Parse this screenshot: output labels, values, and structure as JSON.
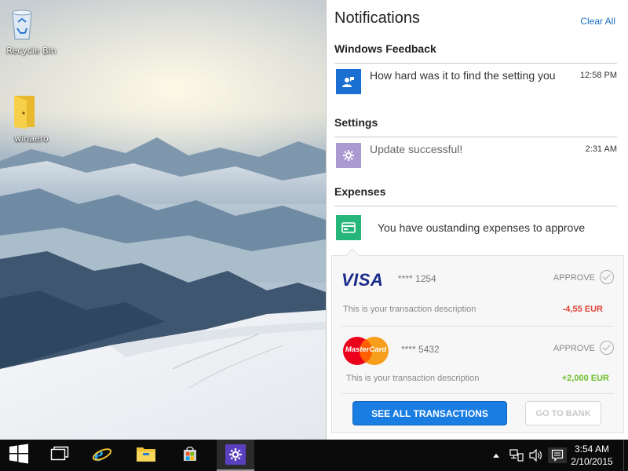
{
  "desktop": {
    "icons": [
      {
        "label": "Recycle Bin",
        "icon": "recycle-bin-icon"
      },
      {
        "label": "winaero",
        "icon": "folder-icon"
      }
    ]
  },
  "notifications": {
    "title": "Notifications",
    "clear_all": "Clear All",
    "groups": [
      {
        "title": "Windows Feedback",
        "items": [
          {
            "text": "How hard was it to find the setting you",
            "time": "12:58 PM",
            "icon": "feedback-icon",
            "icon_bg": "#1a6fd0"
          }
        ]
      },
      {
        "title": "Settings",
        "items": [
          {
            "text": "Update successful!",
            "time": "2:31 AM",
            "icon": "gear-icon",
            "icon_bg": "#a99bd1"
          }
        ]
      },
      {
        "title": "Expenses",
        "items": [
          {
            "text": "You have oustanding expenses to approve",
            "icon": "wallet-icon",
            "icon_bg": "#27b67a"
          }
        ]
      }
    ],
    "expenses": {
      "transactions": [
        {
          "card_brand": "VISA",
          "card_number": "**** 1254",
          "approve_label": "APPROVE",
          "description": "This is your transaction description",
          "amount": "-4,55 EUR",
          "amount_color": "#e0463a"
        },
        {
          "card_brand": "MasterCard",
          "card_number": "**** 5432",
          "approve_label": "APPROVE",
          "description": "This is your transaction description",
          "amount": "+2,000 EUR",
          "amount_color": "#6cbe2a"
        }
      ],
      "see_all_label": "SEE ALL TRANSACTIONS",
      "go_to_bank_label": "GO TO BANK"
    }
  },
  "taskbar": {
    "apps": [
      {
        "name": "start",
        "icon": "windows-logo-icon"
      },
      {
        "name": "task-view",
        "icon": "task-view-icon"
      },
      {
        "name": "internet-explorer",
        "icon": "internet-explorer-icon"
      },
      {
        "name": "file-explorer",
        "icon": "file-explorer-icon"
      },
      {
        "name": "store",
        "icon": "store-icon"
      },
      {
        "name": "settings",
        "icon": "gear-icon",
        "active": true
      }
    ],
    "tray": {
      "icons": [
        "chevron-up-icon",
        "network-icon",
        "volume-icon",
        "action-center-icon"
      ]
    },
    "clock": {
      "time": "3:54 AM",
      "date": "2/10/2015"
    }
  }
}
